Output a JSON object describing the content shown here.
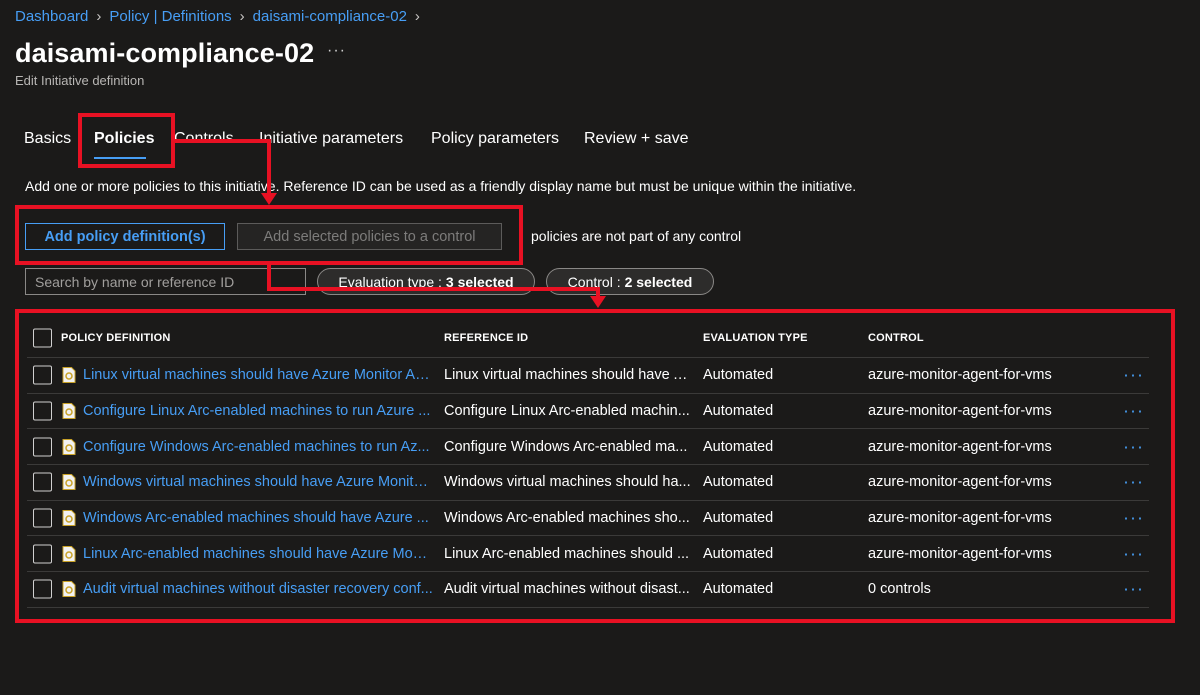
{
  "breadcrumb": [
    {
      "label": "Dashboard"
    },
    {
      "label": "Policy | Definitions"
    },
    {
      "label": "daisami-compliance-02"
    }
  ],
  "header": {
    "title": "daisami-compliance-02",
    "more": "···",
    "subtitle": "Edit Initiative definition"
  },
  "tabs": [
    {
      "label": "Basics"
    },
    {
      "label": "Policies"
    },
    {
      "label": "Controls"
    },
    {
      "label": "Initiative parameters"
    },
    {
      "label": "Policy parameters"
    },
    {
      "label": "Review + save"
    }
  ],
  "description": "Add one or more policies to this initiative. Reference ID can be used as a friendly display name but must be unique within the initiative.",
  "actions": {
    "add_policy": "Add policy definition(s)",
    "add_to_control": "Add selected policies to a control",
    "note": "policies are not part of any control"
  },
  "search": {
    "placeholder": "Search by name or reference ID"
  },
  "filters": [
    {
      "prefix": "Evaluation type :",
      "value": "3 selected"
    },
    {
      "prefix": "Control :",
      "value": "2 selected"
    }
  ],
  "table": {
    "columns": [
      "POLICY DEFINITION",
      "REFERENCE ID",
      "EVALUATION TYPE",
      "CONTROL"
    ],
    "rows": [
      {
        "definition": "Linux virtual machines should have Azure Monitor Ag...",
        "reference": "Linux virtual machines should have A...",
        "eval": "Automated",
        "control": "azure-monitor-agent-for-vms",
        "more": "···"
      },
      {
        "definition": "Configure Linux Arc-enabled machines to run Azure ...",
        "reference": "Configure Linux Arc-enabled machin...",
        "eval": "Automated",
        "control": "azure-monitor-agent-for-vms",
        "more": "···"
      },
      {
        "definition": "Configure Windows Arc-enabled machines to run Az...",
        "reference": "Configure Windows Arc-enabled ma...",
        "eval": "Automated",
        "control": "azure-monitor-agent-for-vms",
        "more": "···"
      },
      {
        "definition": "Windows virtual machines should have Azure Monito...",
        "reference": "Windows virtual machines should ha...",
        "eval": "Automated",
        "control": "azure-monitor-agent-for-vms",
        "more": "···"
      },
      {
        "definition": "Windows Arc-enabled machines should have Azure ...",
        "reference": "Windows Arc-enabled machines sho...",
        "eval": "Automated",
        "control": "azure-monitor-agent-for-vms",
        "more": "···"
      },
      {
        "definition": "Linux Arc-enabled machines should have Azure Moni...",
        "reference": "Linux Arc-enabled machines should ...",
        "eval": "Automated",
        "control": "azure-monitor-agent-for-vms",
        "more": "···"
      },
      {
        "definition": "Audit virtual machines without disaster recovery conf...",
        "reference": "Audit virtual machines without disast...",
        "eval": "Automated",
        "control": "0 controls",
        "more": "···"
      }
    ]
  },
  "colors": {
    "accent": "#479ef5",
    "annotation": "#e81123",
    "background": "#1b1a19"
  }
}
